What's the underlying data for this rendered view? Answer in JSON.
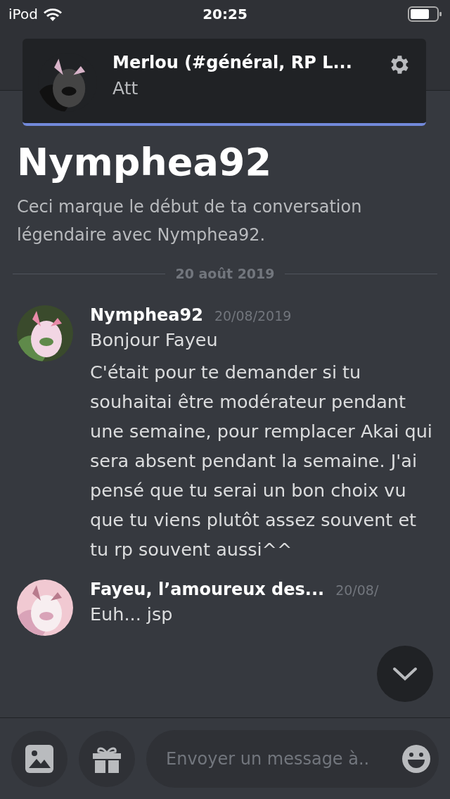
{
  "status_bar": {
    "carrier": "iPod",
    "time": "20:25"
  },
  "notification": {
    "title": "Merlou (#général, RP L...",
    "body": "Att"
  },
  "conversation": {
    "title": "Nymphea92",
    "intro": "Ceci marque le début de ta conversation légendaire avec Nymphea92.",
    "date_divider": "20 août 2019"
  },
  "messages": [
    {
      "author": "Nymphea92",
      "time": "20/08/2019",
      "lines": [
        "Bonjour Fayeu",
        "C'était pour te demander si tu souhaitai être modérateur pendant une semaine, pour remplacer Akai qui sera absent pendant la semaine. J'ai pensé que tu serai un bon choix vu que tu viens plutôt assez souvent et tu rp souvent aussi^^"
      ]
    },
    {
      "author": "Fayeu, l’amoureux des...",
      "time": "20/08/",
      "lines": [
        "Euh... jsp"
      ]
    }
  ],
  "composer": {
    "placeholder": "Envoyer un message à.."
  }
}
